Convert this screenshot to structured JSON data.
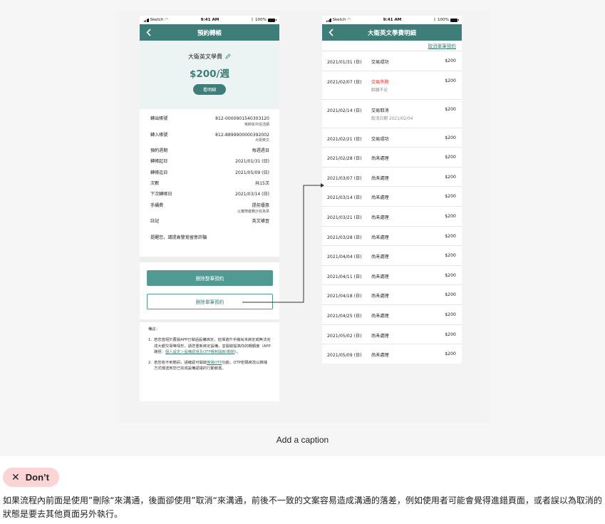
{
  "status_bar": {
    "carrier": "Sketch",
    "time": "9:41 AM",
    "battery": "100%"
  },
  "screen_left": {
    "nav_title": "預約轉帳",
    "payee_name": "大衛英文學費",
    "amount": "$200/週",
    "details_button": "看明細",
    "details": [
      {
        "label": "轉出帳號",
        "value": "812-0000901540303120",
        "sub": "吳帥氣中信活期"
      },
      {
        "label": "轉入帳號",
        "value": "812-8899900000392002",
        "sub": "大衛英文"
      },
      {
        "label": "預約週期",
        "value": "每週週日",
        "sub": ""
      },
      {
        "label": "轉帳起日",
        "value": "2021/01/31 (日)",
        "sub": ""
      },
      {
        "label": "轉帳迄日",
        "value": "2021/05/09 (日)",
        "sub": ""
      },
      {
        "label": "次數",
        "value": "共15次",
        "sub": ""
      },
      {
        "label": "下次轉帳日",
        "value": "2021/03/14 (日)",
        "sub": ""
      },
      {
        "label": "手續費",
        "value": "提前優惠",
        "sub": "以實際繳費計收為準"
      },
      {
        "label": "註記",
        "value": "英文補習",
        "sub": ""
      }
    ],
    "notice": "提醒您，請提高警覺留意詐騙",
    "delete_all_button": "刪除整筆預約",
    "delete_single_button": "刪除單筆預約",
    "notes_title": "備註：",
    "notes": [
      {
        "num": "1.",
        "text": "若您曾經於舊版APP已做過設備綁定，但擇選升手機尚未綁定或無法完成大額交易等情形，請您重新綁定設備，並開啟提高你的轉額度（APP路徑：",
        "link": "個人設定＞設備認證及OTP權制開啟/關閉",
        "tail": "）。"
      },
      {
        "num": "2.",
        "text": "若您收不到簡訊，請確認可開啟",
        "link": "推播OTP",
        "tail": "功能，OTP密碼將改以推播方式傳送到您已完成設備認證的行動裝置。"
      }
    ]
  },
  "screen_right": {
    "nav_title": "大衛英文學費明細",
    "cancel_link": "取消單筆預約",
    "records": [
      {
        "date": "2021/01/31 (日)",
        "status": "交易成功",
        "note": "",
        "amount": "$200"
      },
      {
        "date": "2021/02/07 (日)",
        "status": "交易失敗",
        "note": "餘額不足",
        "amount": "$200"
      },
      {
        "date": "2021/02/14 (日)",
        "status": "交易取消",
        "note": "取消日期 2021/02/04",
        "amount": "$200"
      },
      {
        "date": "2021/02/21 (日)",
        "status": "交易成功",
        "note": "",
        "amount": "$200"
      },
      {
        "date": "2021/02/28 (日)",
        "status": "尚未處理",
        "note": "",
        "amount": "$200"
      },
      {
        "date": "2021/03/07 (日)",
        "status": "尚未處理",
        "note": "",
        "amount": "$200"
      },
      {
        "date": "2021/03/14 (日)",
        "status": "尚未處理",
        "note": "",
        "amount": "$200"
      },
      {
        "date": "2021/03/21 (日)",
        "status": "尚未處理",
        "note": "",
        "amount": "$200"
      },
      {
        "date": "2021/03/28 (日)",
        "status": "尚未處理",
        "note": "",
        "amount": "$200"
      },
      {
        "date": "2021/04/04 (日)",
        "status": "尚未處理",
        "note": "",
        "amount": "$200"
      },
      {
        "date": "2021/04/11 (日)",
        "status": "尚未處理",
        "note": "",
        "amount": "$200"
      },
      {
        "date": "2021/04/18 (日)",
        "status": "尚未處理",
        "note": "",
        "amount": "$200"
      },
      {
        "date": "2021/04/25 (日)",
        "status": "尚未處理",
        "note": "",
        "amount": "$200"
      },
      {
        "date": "2021/05/02 (日)",
        "status": "尚未處理",
        "note": "",
        "amount": "$200"
      },
      {
        "date": "2021/05/09 (日)",
        "status": "尚未處理",
        "note": "",
        "amount": "$200"
      }
    ]
  },
  "caption": "Add a caption",
  "badge": {
    "icon": "close-icon",
    "label": "Don’t"
  },
  "description": "如果流程內前面是使用”刪除“來溝通，後面卻使用”取消“來溝通，前後不一致的文案容易造成溝通的落差，例如使用者可能會覺得進錯頁面，或者誤以為取消的狀態是要去其他頁面另外執行。",
  "colors": {
    "primary": "#3e7e78",
    "button": "#4f9a92",
    "hero_bg": "#ebf4f2",
    "fail": "#e0322c",
    "badge_bg": "#fbd5d5"
  }
}
